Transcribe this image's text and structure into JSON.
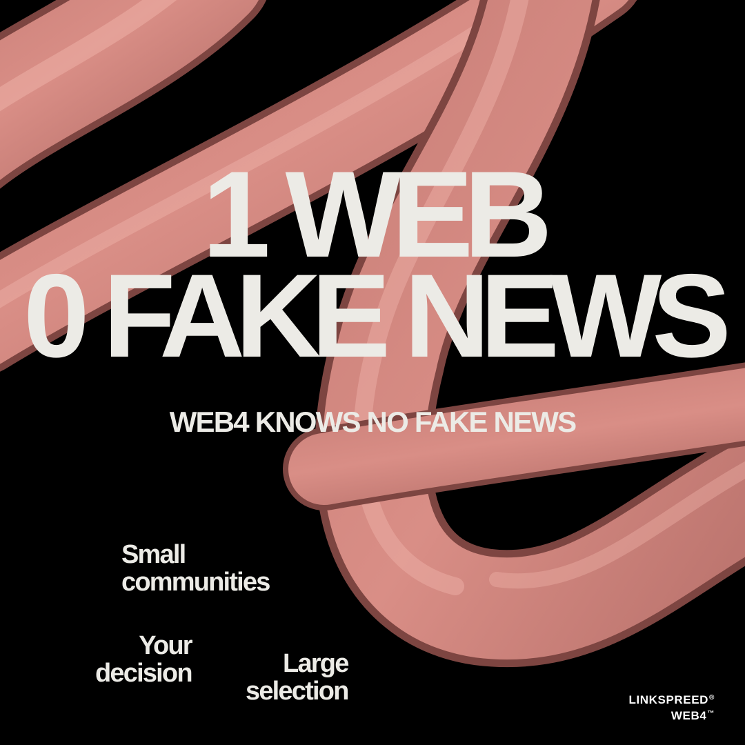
{
  "headline": {
    "line1": "1 WEB",
    "line2": "0 FAKE NEWS"
  },
  "subheadline": "WEB4 KNOWS NO FAKE NEWS",
  "features": [
    {
      "line1": "Small",
      "line2": "communities"
    },
    {
      "line1": "Your",
      "line2": "decision"
    },
    {
      "line1": "Large",
      "line2": "selection"
    }
  ],
  "brand": {
    "line1": "LINKSPREED",
    "mark1": "®",
    "line2": "WEB4",
    "mark2": "™"
  },
  "colors": {
    "background": "#000000",
    "text": "#ECEBE6",
    "tube": "#D98E86",
    "tube_highlight": "#F2B8B0",
    "tube_shadow": "#8A4E4A"
  },
  "decoration": "pink-3d-tube"
}
